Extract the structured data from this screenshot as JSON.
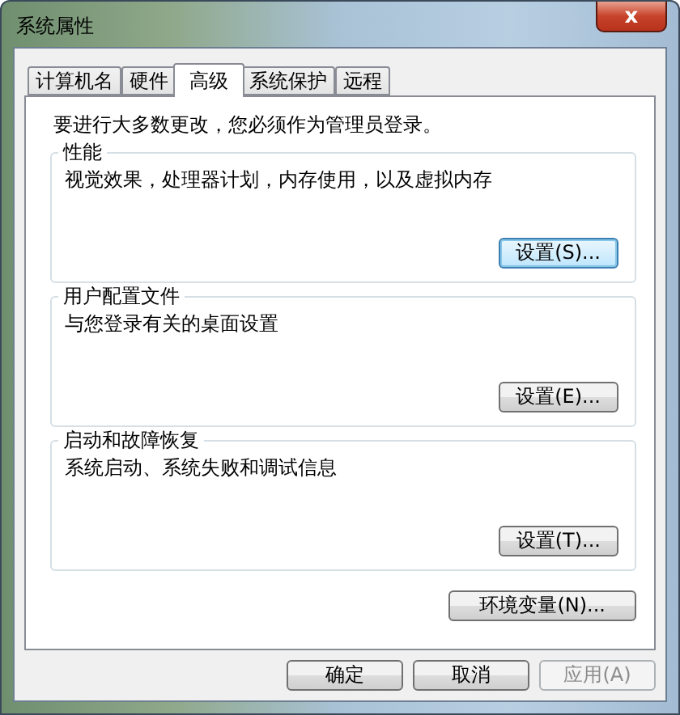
{
  "window": {
    "title": "系统属性",
    "close_label": "x"
  },
  "tabs": [
    {
      "label": "计算机名",
      "selected": false
    },
    {
      "label": "硬件",
      "selected": false
    },
    {
      "label": "高级",
      "selected": true
    },
    {
      "label": "系统保护",
      "selected": false
    },
    {
      "label": "远程",
      "selected": false
    }
  ],
  "notice": "要进行大多数更改，您必须作为管理员登录。",
  "groups": [
    {
      "title": "性能",
      "description": "视觉效果，处理器计划，内存使用，以及虚拟内存",
      "button": {
        "label": "设置(S)...",
        "focused": true
      }
    },
    {
      "title": "用户配置文件",
      "description": "与您登录有关的桌面设置",
      "button": {
        "label": "设置(E)...",
        "focused": false
      }
    },
    {
      "title": "启动和故障恢复",
      "description": "系统启动、系统失败和调试信息",
      "button": {
        "label": "设置(T)...",
        "focused": false
      }
    }
  ],
  "env_button": {
    "label": "环境变量(N)...",
    "focused": false
  },
  "buttons": [
    {
      "label": "确定",
      "disabled": false
    },
    {
      "label": "取消",
      "disabled": false
    },
    {
      "label": "应用(A)",
      "disabled": true
    }
  ]
}
